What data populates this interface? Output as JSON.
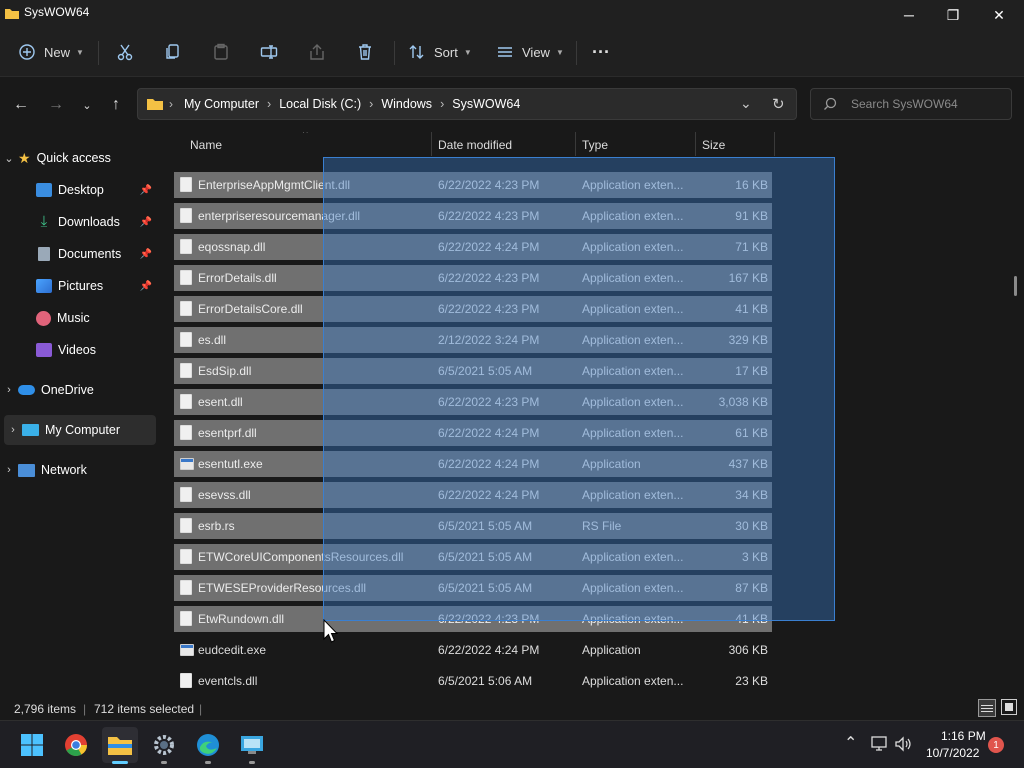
{
  "window": {
    "title": "SysWOW64",
    "minimize": "─",
    "maximize": "❐",
    "close": "✕"
  },
  "toolbar": {
    "new_label": "New",
    "sort_label": "Sort",
    "view_label": "View",
    "more_label": "···"
  },
  "nav": {
    "breadcrumbs": [
      "My Computer",
      "Local Disk (C:)",
      "Windows",
      "SysWOW64"
    ],
    "search_placeholder": "Search SysWOW64"
  },
  "sidebar": {
    "quick_access": "Quick access",
    "items": [
      {
        "label": "Desktop",
        "pinned": true,
        "icon": "desktop-icon"
      },
      {
        "label": "Downloads",
        "pinned": true,
        "icon": "download-icon"
      },
      {
        "label": "Documents",
        "pinned": true,
        "icon": "document-icon"
      },
      {
        "label": "Pictures",
        "pinned": true,
        "icon": "pictures-icon"
      },
      {
        "label": "Music",
        "pinned": false,
        "icon": "music-icon"
      },
      {
        "label": "Videos",
        "pinned": false,
        "icon": "video-icon"
      }
    ],
    "onedrive": "OneDrive",
    "my_computer": "My Computer",
    "network": "Network"
  },
  "columns": {
    "name": "Name",
    "date": "Date modified",
    "type": "Type",
    "size": "Size"
  },
  "files": [
    {
      "name": "EnterpriseAppMgmtClient.dll",
      "date": "6/22/2022 4:23 PM",
      "type": "Application exten...",
      "size": "16 KB",
      "selected": true,
      "kind": "dll"
    },
    {
      "name": "enterpriseresourcemanager.dll",
      "date": "6/22/2022 4:23 PM",
      "type": "Application exten...",
      "size": "91 KB",
      "selected": true,
      "kind": "dll"
    },
    {
      "name": "eqossnap.dll",
      "date": "6/22/2022 4:24 PM",
      "type": "Application exten...",
      "size": "71 KB",
      "selected": true,
      "kind": "dll"
    },
    {
      "name": "ErrorDetails.dll",
      "date": "6/22/2022 4:23 PM",
      "type": "Application exten...",
      "size": "167 KB",
      "selected": true,
      "kind": "dll"
    },
    {
      "name": "ErrorDetailsCore.dll",
      "date": "6/22/2022 4:23 PM",
      "type": "Application exten...",
      "size": "41 KB",
      "selected": true,
      "kind": "dll"
    },
    {
      "name": "es.dll",
      "date": "2/12/2022 3:24 PM",
      "type": "Application exten...",
      "size": "329 KB",
      "selected": true,
      "kind": "dll"
    },
    {
      "name": "EsdSip.dll",
      "date": "6/5/2021 5:05 AM",
      "type": "Application exten...",
      "size": "17 KB",
      "selected": true,
      "kind": "dll"
    },
    {
      "name": "esent.dll",
      "date": "6/22/2022 4:23 PM",
      "type": "Application exten...",
      "size": "3,038 KB",
      "selected": true,
      "kind": "dll"
    },
    {
      "name": "esentprf.dll",
      "date": "6/22/2022 4:24 PM",
      "type": "Application exten...",
      "size": "61 KB",
      "selected": true,
      "kind": "dll"
    },
    {
      "name": "esentutl.exe",
      "date": "6/22/2022 4:24 PM",
      "type": "Application",
      "size": "437 KB",
      "selected": true,
      "kind": "exe"
    },
    {
      "name": "esevss.dll",
      "date": "6/22/2022 4:24 PM",
      "type": "Application exten...",
      "size": "34 KB",
      "selected": true,
      "kind": "dll"
    },
    {
      "name": "esrb.rs",
      "date": "6/5/2021 5:05 AM",
      "type": "RS File",
      "size": "30 KB",
      "selected": true,
      "kind": "file"
    },
    {
      "name": "ETWCoreUIComponentsResources.dll",
      "date": "6/5/2021 5:05 AM",
      "type": "Application exten...",
      "size": "3 KB",
      "selected": true,
      "kind": "dll"
    },
    {
      "name": "ETWESEProviderResources.dll",
      "date": "6/5/2021 5:05 AM",
      "type": "Application exten...",
      "size": "87 KB",
      "selected": true,
      "kind": "dll"
    },
    {
      "name": "EtwRundown.dll",
      "date": "6/22/2022 4:23 PM",
      "type": "Application exten...",
      "size": "41 KB",
      "selected": true,
      "kind": "dll"
    },
    {
      "name": "eudcedit.exe",
      "date": "6/22/2022 4:24 PM",
      "type": "Application",
      "size": "306 KB",
      "selected": false,
      "kind": "exe"
    },
    {
      "name": "eventcls.dll",
      "date": "6/5/2021 5:06 AM",
      "type": "Application exten...",
      "size": "23 KB",
      "selected": false,
      "kind": "dll"
    }
  ],
  "status": {
    "item_count": "2,796 items",
    "selected_count": "712 items selected"
  },
  "taskbar": {
    "time": "1:16 PM",
    "date": "10/7/2022",
    "notification_count": "1"
  },
  "colors": {
    "accent": "#3678c4",
    "selected_row": "#707070",
    "background": "#191919"
  }
}
